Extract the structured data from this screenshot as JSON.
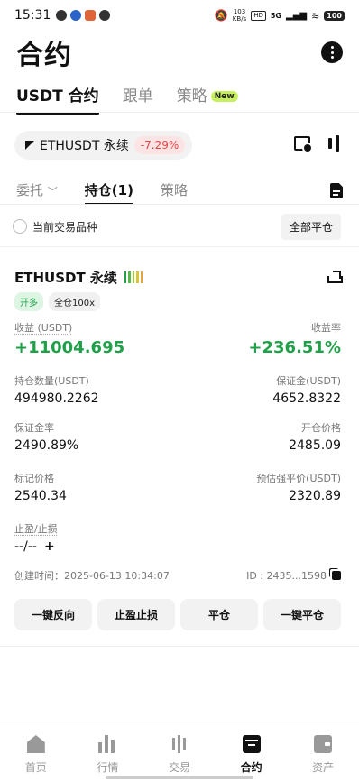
{
  "status_bar": {
    "time": "15:31",
    "net_speed_value": "103",
    "net_speed_unit": "KB/s",
    "hd": "HD",
    "network": "5G",
    "battery": "100"
  },
  "header": {
    "title": "合约"
  },
  "tabs": [
    {
      "label": "USDT 合约",
      "active": true
    },
    {
      "label": "跟单"
    },
    {
      "label": "策略",
      "badge": "New"
    }
  ],
  "pair": {
    "name": "ETHUSDT  永续",
    "change": "-7.29%"
  },
  "subtabs": [
    {
      "label": "委托"
    },
    {
      "label": "持仓(1)"
    },
    {
      "label": "策略"
    }
  ],
  "filter": {
    "current_symbol_label": "当前交易品种",
    "close_all_label": "全部平仓"
  },
  "position": {
    "symbol": "ETHUSDT 永续",
    "side_tag": "开多",
    "margin_tag": "全仓100x",
    "leverage_colors": [
      "#21a04a",
      "#58b84a",
      "#9cc93c",
      "#d9c53a",
      "#e3a53a"
    ],
    "pnl_label": "收益 (USDT)",
    "pnl_value": "+11004.695",
    "roe_label": "收益率",
    "roe_value": "+236.51%",
    "size_label": "持仓数量(USDT)",
    "size_value": "494980.2262",
    "margin_label": "保证金(USDT)",
    "margin_value": "4652.8322",
    "margin_ratio_label": "保证金率",
    "margin_ratio_value": "2490.89%",
    "entry_label": "开仓价格",
    "entry_value": "2485.09",
    "mark_label": "标记价格",
    "mark_value": "2540.34",
    "liq_label": "预估强平价(USDT)",
    "liq_value": "2320.89",
    "tpsl_label": "止盈/止损",
    "tpsl_value": "--/--",
    "created_label": "创建时间：2025-06-13 10:34:07",
    "id_label": "ID : 2435...1598"
  },
  "actions": [
    "一键反向",
    "止盈止损",
    "平仓",
    "一键平仓"
  ],
  "bottom_nav": [
    {
      "label": "首页"
    },
    {
      "label": "行情"
    },
    {
      "label": "交易"
    },
    {
      "label": "合约",
      "active": true
    },
    {
      "label": "资产"
    }
  ]
}
